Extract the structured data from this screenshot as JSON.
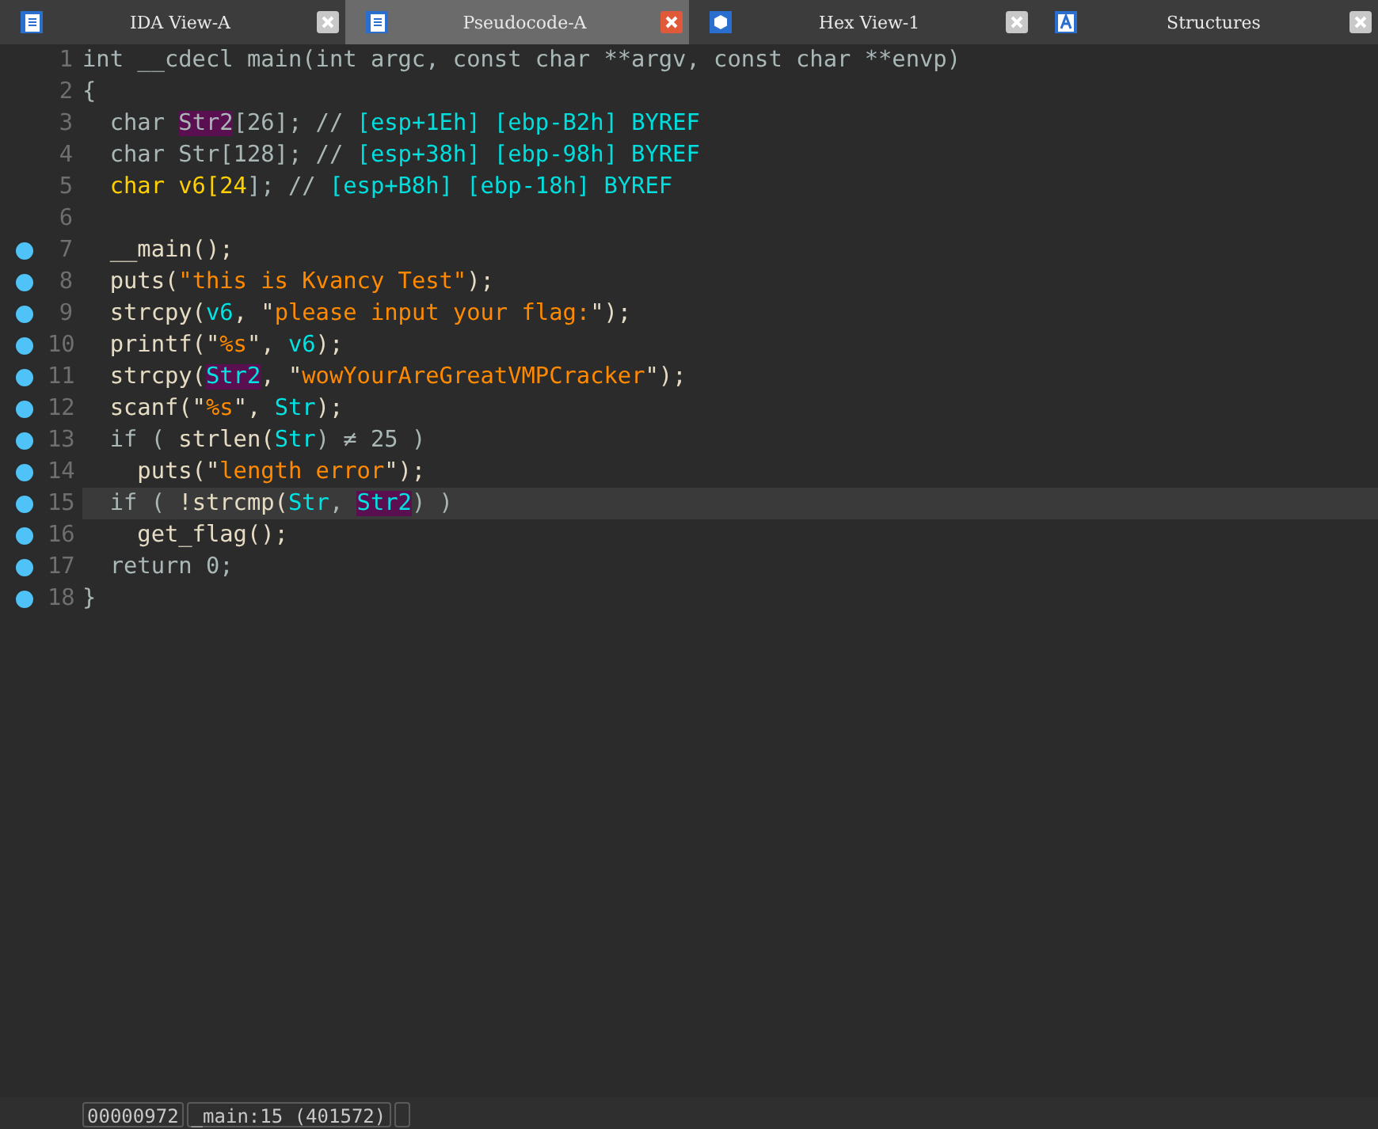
{
  "tabs": [
    {
      "label": "IDA View-A",
      "kind": "listing",
      "selected": false
    },
    {
      "label": "Pseudocode-A",
      "kind": "listing",
      "selected": true
    },
    {
      "label": "Hex View-1",
      "kind": "hex",
      "selected": false
    },
    {
      "label": "Structures",
      "kind": "struct",
      "selected": false
    }
  ],
  "code": [
    {
      "number": "1",
      "breakpoint": false,
      "current": false,
      "tokens": [
        {
          "text": "int __cdecl main(int argc, const char **argv, const char **envp)",
          "kind": "plain"
        }
      ]
    },
    {
      "number": "2",
      "breakpoint": false,
      "current": false,
      "tokens": [
        {
          "text": "{",
          "kind": "plain"
        }
      ]
    },
    {
      "number": "3",
      "breakpoint": false,
      "current": false,
      "tokens": [
        {
          "text": "  char ",
          "kind": "plain"
        },
        {
          "text": "Str2",
          "kind": "plain",
          "marked": true
        },
        {
          "text": "[26]; // ",
          "kind": "plain"
        },
        {
          "text": "[esp+1Eh] [ebp-B2h] BYREF",
          "kind": "note"
        }
      ]
    },
    {
      "number": "4",
      "breakpoint": false,
      "current": false,
      "tokens": [
        {
          "text": "  char Str[128]; // ",
          "kind": "plain"
        },
        {
          "text": "[esp+38h] [ebp-98h] BYREF",
          "kind": "note"
        }
      ]
    },
    {
      "number": "5",
      "breakpoint": false,
      "current": false,
      "tokens": [
        {
          "text": "  char v6[24",
          "kind": "selected"
        },
        {
          "text": "]; // ",
          "kind": "plain"
        },
        {
          "text": "[esp+B8h] [ebp-18h] BYREF",
          "kind": "note"
        }
      ]
    },
    {
      "number": "6",
      "breakpoint": false,
      "current": false
    },
    {
      "number": "7",
      "breakpoint": true,
      "current": false,
      "tokens": [
        {
          "text": "  __main();",
          "kind": "call"
        }
      ]
    },
    {
      "number": "8",
      "breakpoint": true,
      "current": false,
      "tokens": [
        {
          "text": "  puts(",
          "kind": "call"
        },
        {
          "text": "\"this is Kvancy Test\"",
          "kind": "string"
        },
        {
          "text": ");",
          "kind": "call"
        }
      ]
    },
    {
      "number": "9",
      "breakpoint": true,
      "current": false,
      "tokens": [
        {
          "text": "  strcpy(",
          "kind": "call"
        },
        {
          "text": "v6",
          "kind": "ident"
        },
        {
          "text": ", \"",
          "kind": "call"
        },
        {
          "text": "please input your flag:",
          "kind": "string"
        },
        {
          "text": "\");",
          "kind": "call"
        }
      ]
    },
    {
      "number": "10",
      "breakpoint": true,
      "current": false,
      "tokens": [
        {
          "text": "  printf(\"",
          "kind": "call"
        },
        {
          "text": "%s",
          "kind": "string"
        },
        {
          "text": "\", ",
          "kind": "call"
        },
        {
          "text": "v6",
          "kind": "ident"
        },
        {
          "text": ");",
          "kind": "call"
        }
      ]
    },
    {
      "number": "11",
      "breakpoint": true,
      "current": false,
      "tokens": [
        {
          "text": "  strcpy(",
          "kind": "call"
        },
        {
          "text": "Str2",
          "kind": "ident",
          "marked": true
        },
        {
          "text": ", \"",
          "kind": "call"
        },
        {
          "text": "wowYourAreGreatVMPCracker",
          "kind": "string"
        },
        {
          "text": "\");",
          "kind": "call"
        }
      ]
    },
    {
      "number": "12",
      "breakpoint": true,
      "current": false,
      "tokens": [
        {
          "text": "  scanf(\"",
          "kind": "call"
        },
        {
          "text": "%s",
          "kind": "string"
        },
        {
          "text": "\", ",
          "kind": "call"
        },
        {
          "text": "Str",
          "kind": "ident"
        },
        {
          "text": ");",
          "kind": "call"
        }
      ]
    },
    {
      "number": "13",
      "breakpoint": true,
      "current": false,
      "tokens": [
        {
          "text": "  if ( ",
          "kind": "plain"
        },
        {
          "text": "strlen(",
          "kind": "call"
        },
        {
          "text": "Str",
          "kind": "ident"
        },
        {
          "text": ") ≠ 25 )",
          "kind": "plain"
        }
      ]
    },
    {
      "number": "14",
      "breakpoint": true,
      "current": false,
      "tokens": [
        {
          "text": "    puts(\"",
          "kind": "call"
        },
        {
          "text": "length error",
          "kind": "string"
        },
        {
          "text": "\");",
          "kind": "call"
        }
      ]
    },
    {
      "number": "15",
      "breakpoint": true,
      "current": true,
      "tokens": [
        {
          "text": "  if ( ",
          "kind": "plain"
        },
        {
          "text": "!strcmp(",
          "kind": "call"
        },
        {
          "text": "Str",
          "kind": "ident"
        },
        {
          "text": ", ",
          "kind": "plain"
        },
        {
          "text": "Str2",
          "kind": "ident",
          "marked": true
        },
        {
          "text": ") )",
          "kind": "plain"
        }
      ]
    },
    {
      "number": "16",
      "breakpoint": true,
      "current": false,
      "tokens": [
        {
          "text": "    get_flag();",
          "kind": "call"
        }
      ]
    },
    {
      "number": "17",
      "breakpoint": true,
      "current": false,
      "tokens": [
        {
          "text": "  return 0;",
          "kind": "plain"
        }
      ]
    },
    {
      "number": "18",
      "breakpoint": true,
      "current": false,
      "tokens": [
        {
          "text": "}",
          "kind": "plain"
        }
      ]
    }
  ],
  "status_bar": [
    "00000972",
    "_main:15 (401572)"
  ]
}
